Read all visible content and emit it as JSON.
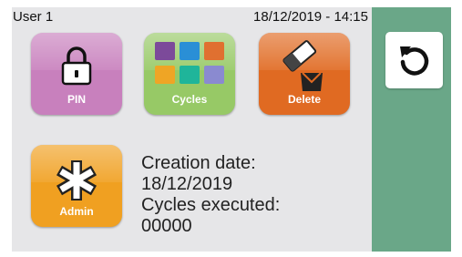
{
  "status_bar": {
    "user": "User 1",
    "datetime": "18/12/2019 - 14:15"
  },
  "tiles": [
    {
      "label": "PIN",
      "icon": "lock-icon",
      "color": "#c880bd"
    },
    {
      "label": "Cycles",
      "icon": "grid-icon",
      "color": "#97c966"
    },
    {
      "label": "Delete",
      "icon": "eraser-icon",
      "color": "#e06a22"
    },
    {
      "label": "Admin",
      "icon": "asterisk-icon",
      "color": "#f0a021"
    }
  ],
  "info": {
    "creation_label": "Creation date:",
    "creation_value": "18/12/2019",
    "cycles_label": "Cycles executed:",
    "cycles_value": "00000"
  },
  "sidebar": {
    "back_icon": "back-arrow-icon",
    "color": "#6aa788"
  }
}
